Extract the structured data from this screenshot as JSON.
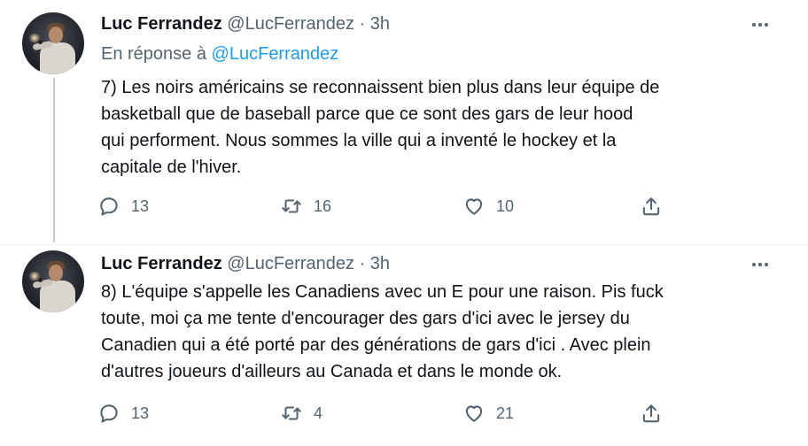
{
  "tweets": [
    {
      "author_name": "Luc Ferrandez",
      "author_handle": "@LucFerrandez",
      "separator": "·",
      "time": "3h",
      "reply_label": "En réponse à",
      "reply_mention": "@LucFerrandez",
      "text": "7) Les noirs américains se reconnaissent bien plus dans leur équipe de\nbasketball que de baseball parce que ce sont des gars de leur hood\nqui performent. Nous sommes la ville qui a inventé le hockey et la\ncapitale de l'hiver.",
      "replies": "13",
      "retweets": "16",
      "likes": "10"
    },
    {
      "author_name": "Luc Ferrandez",
      "author_handle": "@LucFerrandez",
      "separator": "·",
      "time": "3h",
      "text": "8) L'équipe s'appelle les Canadiens avec un E pour une raison. Pis fuck\ntoute, moi ça me tente d'encourager des gars d'ici avec le jersey du\nCanadien qui a été porté par des générations de gars d'ici . Avec plein\nd'autres joueurs d'ailleurs au Canada et dans le monde ok.",
      "replies": "13",
      "retweets": "4",
      "likes": "21"
    }
  ],
  "icons": {
    "reply": "speech-bubble",
    "retweet": "retweet-arrows",
    "like": "heart",
    "share": "share-upload",
    "more": "three-dots"
  },
  "colors": {
    "text": "#0f1419",
    "secondary": "#536471",
    "link": "#1d9bf0",
    "thread_line": "#c4cfd6"
  }
}
